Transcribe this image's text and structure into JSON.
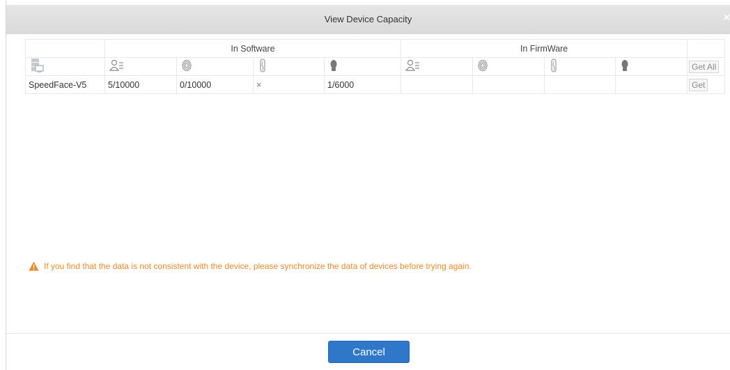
{
  "dialog": {
    "title": "View Device Capacity",
    "close_symbol": "×"
  },
  "table": {
    "group_headers": [
      "In Software",
      "In FirmWare"
    ],
    "column_icons": [
      "device-icon",
      "user-list-icon",
      "fingerprint-icon",
      "finger-vein-icon",
      "face-icon"
    ],
    "get_all_label": "Get All",
    "rows": [
      {
        "device": "SpeedFace-V5",
        "software": [
          "5/10000",
          "0/10000",
          "×",
          "1/6000"
        ],
        "firmware": [
          "",
          "",
          "",
          ""
        ],
        "get_label": "Get"
      }
    ]
  },
  "warning": {
    "icon": "warning-triangle-icon",
    "text": "If you find that the data is not consistent with the device, please synchronize the data of devices before trying again.",
    "color": "#e8892c"
  },
  "footer": {
    "cancel_label": "Cancel",
    "accent_color": "#2f77c9"
  }
}
